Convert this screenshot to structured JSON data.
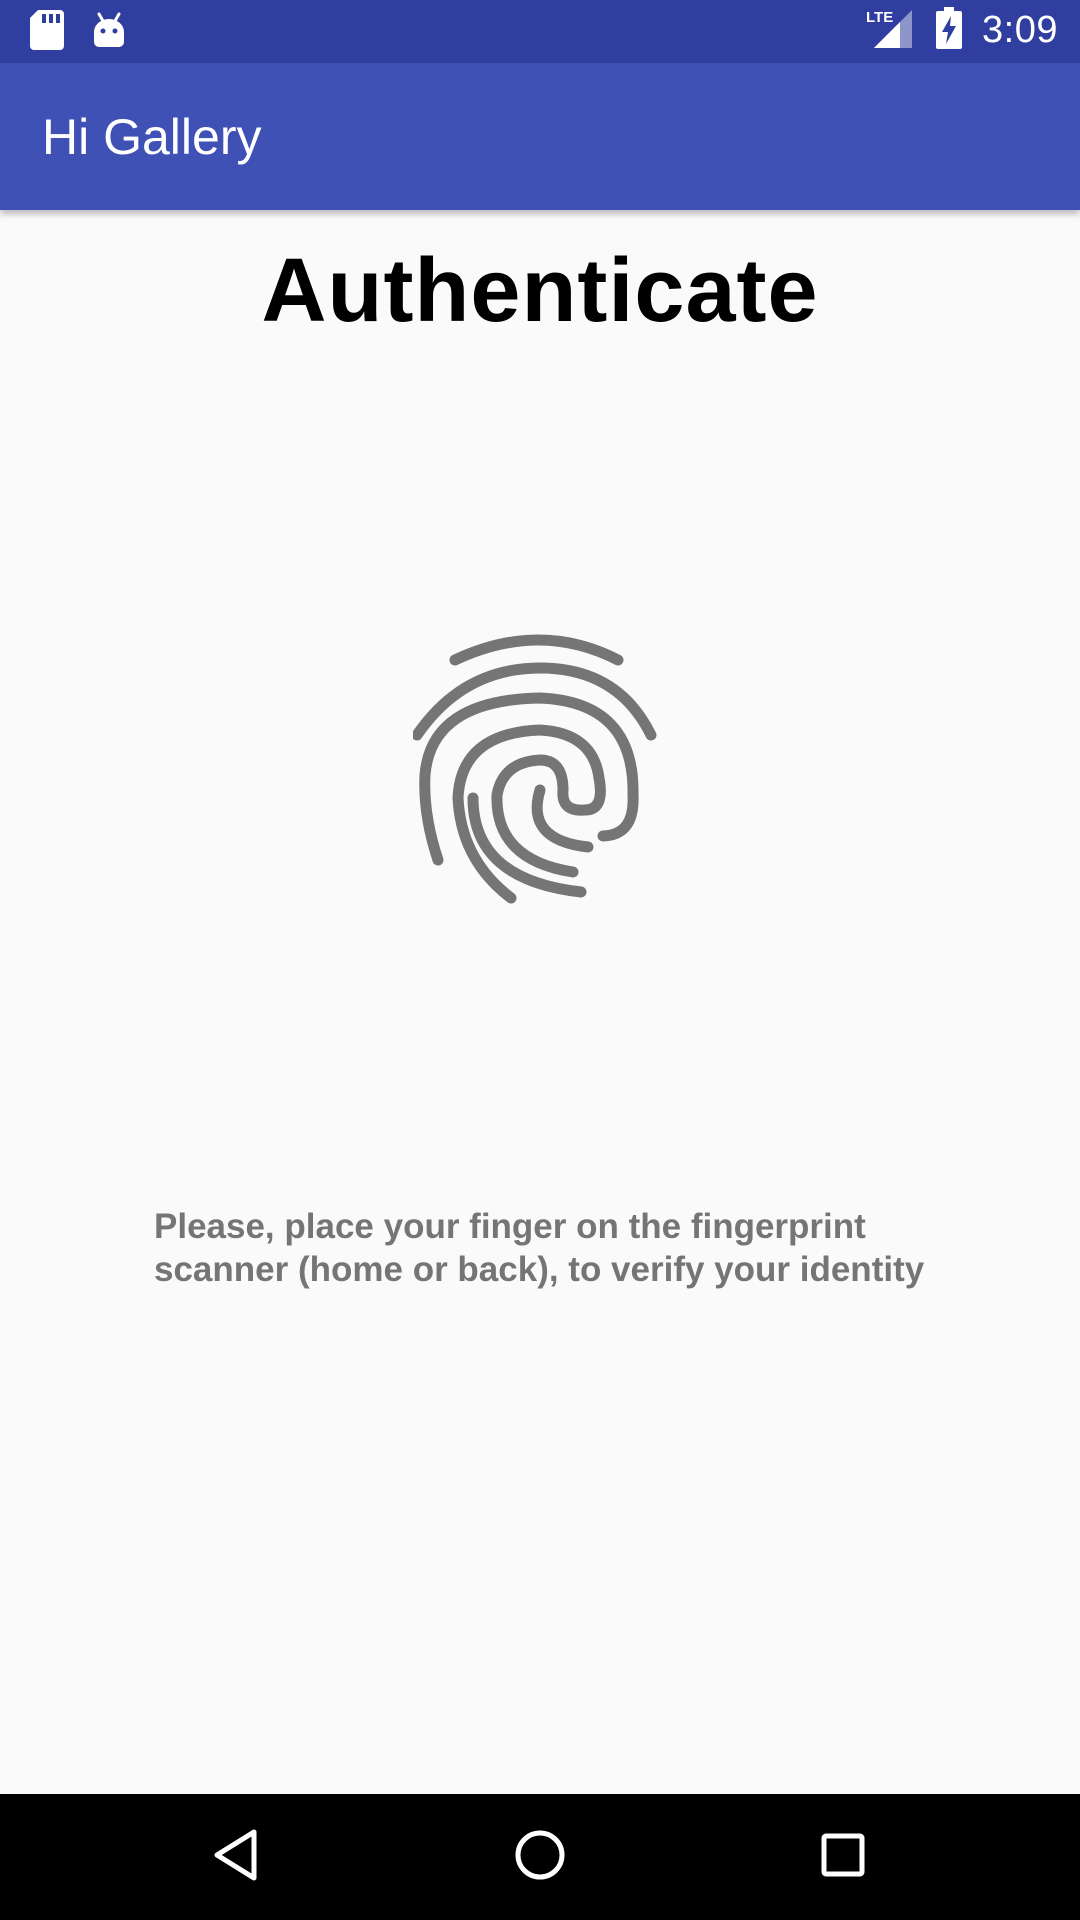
{
  "status_bar": {
    "time": "3:09",
    "network": "LTE",
    "icons": [
      "sd-card-icon",
      "android-icon",
      "signal-icon",
      "battery-charging-icon"
    ]
  },
  "app_bar": {
    "title": "Hi Gallery"
  },
  "main": {
    "heading": "Authenticate",
    "icon": "fingerprint-icon",
    "instruction": "Please, place your finger on the fingerprint scanner (home or back), to verify your identity"
  },
  "nav_bar": {
    "buttons": [
      "back-icon",
      "home-icon",
      "recents-icon"
    ]
  },
  "colors": {
    "status_bar": "#303f9f",
    "app_bar": "#3f51b5",
    "background": "#fafafa",
    "fingerprint": "#757575",
    "instruction_text": "#757575"
  }
}
